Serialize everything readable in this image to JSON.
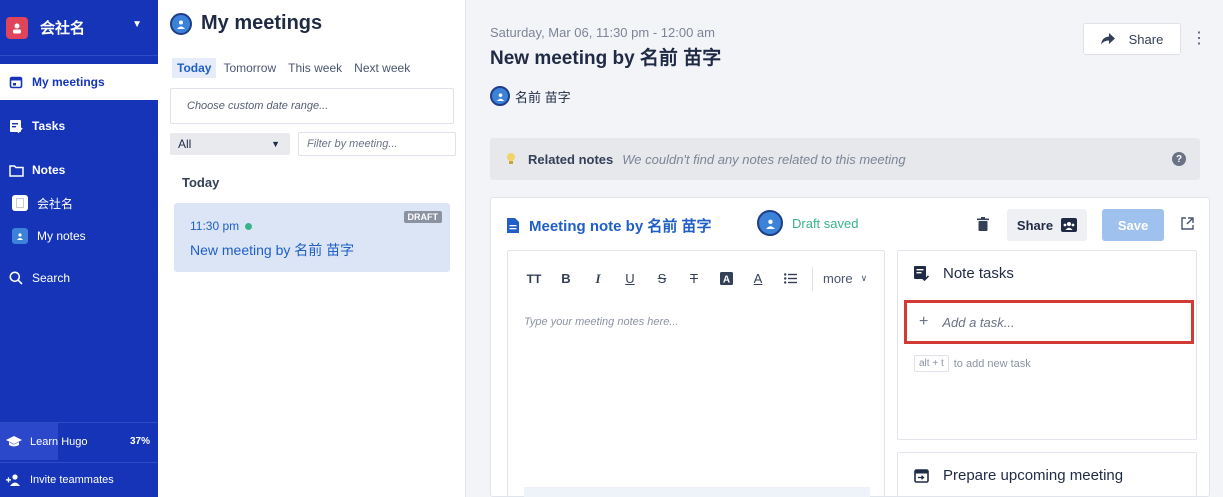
{
  "sidebar": {
    "org_name": "会社名",
    "nav": {
      "my_meetings": "My meetings",
      "tasks": "Tasks",
      "notes": "Notes",
      "search": "Search"
    },
    "notes_items": [
      "会社名",
      "My notes"
    ],
    "learn": {
      "label": "Learn Hugo",
      "percent_text": "37%",
      "progress": 0.37
    },
    "invite": "Invite teammates"
  },
  "list": {
    "title": "My meetings",
    "tabs": [
      "Today",
      "Tomorrow",
      "This week",
      "Next week"
    ],
    "active_tab": "Today",
    "date_range_placeholder": "Choose custom date range...",
    "filter_select": "All",
    "filter_placeholder": "Filter by meeting...",
    "section": "Today",
    "meeting": {
      "time": "11:30 pm",
      "name": "New meeting by 名前 苗字",
      "badge": "DRAFT"
    }
  },
  "main": {
    "datetime": "Saturday, Mar 06, 11:30 pm - 12:00 am",
    "title": "New meeting by 名前 苗字",
    "attendee": "名前 苗字",
    "share_label": "Share",
    "related": {
      "label": "Related notes",
      "message": "We couldn't find any notes related to this meeting",
      "help": "?"
    },
    "note": {
      "title": "Meeting note by 名前 苗字",
      "status": "Draft saved",
      "share_label": "Share",
      "save_label": "Save",
      "editor_placeholder": "Type your meeting notes here...",
      "toolbar_more": "more"
    },
    "tasks": {
      "title": "Note tasks",
      "add_placeholder": "Add a task...",
      "hint_key": "alt + t",
      "hint_text": "to add new task"
    },
    "prepare": {
      "title": "Prepare upcoming meeting"
    }
  },
  "colors": {
    "sidebar": "#1534b8",
    "accent_blue": "#1f5fc7",
    "status_green": "#38b48b",
    "highlight_red": "#d23a36",
    "save_button": "#9ec1ee"
  }
}
